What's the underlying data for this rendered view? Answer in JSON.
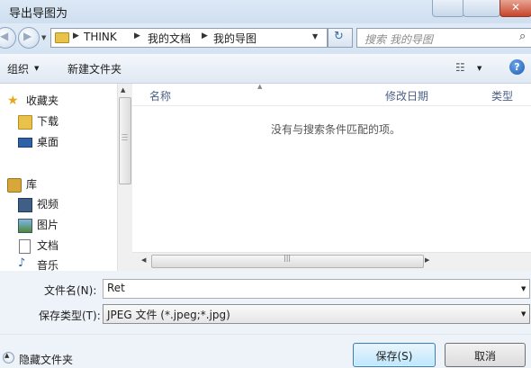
{
  "window": {
    "title": "导出导图为"
  },
  "address": {
    "crumbs": [
      "THINK",
      "我的文档",
      "我的导图"
    ],
    "separator": "▶"
  },
  "search": {
    "placeholder": "搜索 我的导图"
  },
  "toolbar": {
    "organize_label": "组织 ",
    "new_folder_label": "新建文件夹"
  },
  "sidebar": {
    "items": [
      {
        "label": "收藏夹",
        "icon": "star-icon"
      },
      {
        "label": "下载",
        "icon": "download-folder-icon"
      },
      {
        "label": "桌面",
        "icon": "desktop-icon"
      },
      {
        "label": "库",
        "icon": "library-icon"
      },
      {
        "label": "视频",
        "icon": "video-icon"
      },
      {
        "label": "图片",
        "icon": "picture-icon"
      },
      {
        "label": "文档",
        "icon": "document-icon"
      },
      {
        "label": "音乐",
        "icon": "music-icon"
      }
    ]
  },
  "filelist": {
    "columns": [
      "名称",
      "修改日期",
      "类型"
    ],
    "empty_message": "没有与搜索条件匹配的项。"
  },
  "form": {
    "filename_label": "文件名(N):",
    "filename_value": "Ret",
    "filetype_label": "保存类型(T):",
    "filetype_value": "JPEG 文件 (*.jpeg;*.jpg)"
  },
  "footer": {
    "hide_folders_label": "隐藏文件夹"
  },
  "buttons": {
    "save": "保存(S)",
    "cancel": "取消"
  },
  "colors": {
    "accent": "#3c7fb1",
    "help": "#1f5bb5"
  }
}
